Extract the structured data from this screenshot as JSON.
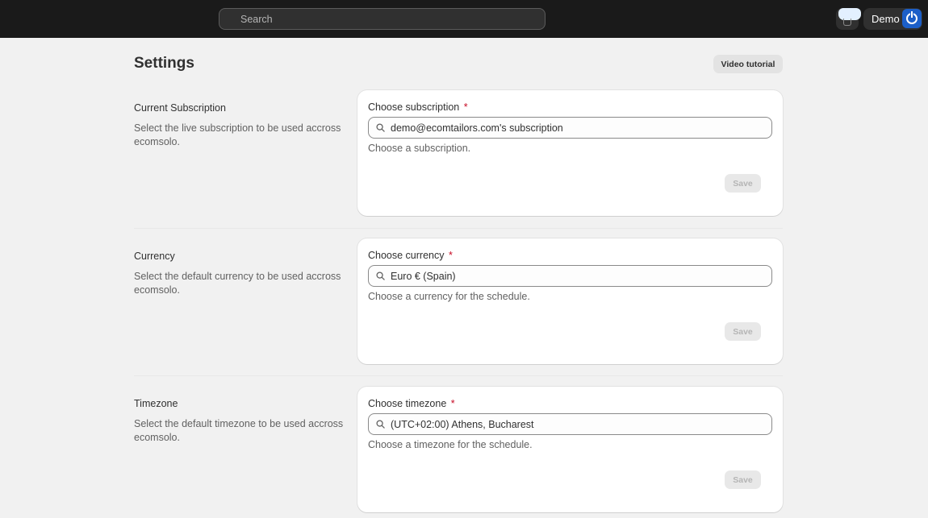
{
  "topbar": {
    "search_placeholder": "Search",
    "user_name": "Demo"
  },
  "page": {
    "title": "Settings",
    "video_tutorial_label": "Video tutorial"
  },
  "sections": [
    {
      "heading": "Current Subscription",
      "description": "Select the live subscription to be used accross ecomsolo.",
      "field_label": "Choose subscription",
      "required_mark": "*",
      "value": "demo@ecomtailors.com's subscription",
      "help": "Choose a subscription.",
      "save_label": "Save"
    },
    {
      "heading": "Currency",
      "description": "Select the default currency to be used accross ecomsolo.",
      "field_label": "Choose currency",
      "required_mark": "*",
      "value": "Euro € (Spain)",
      "help": "Choose a currency for the schedule.",
      "save_label": "Save"
    },
    {
      "heading": "Timezone",
      "description": "Select the default timezone to be used accross ecomsolo.",
      "field_label": "Choose timezone",
      "required_mark": "*",
      "value": "(UTC+02:00) Athens, Bucharest",
      "help": "Choose a timezone for the schedule.",
      "save_label": "Save"
    }
  ]
}
